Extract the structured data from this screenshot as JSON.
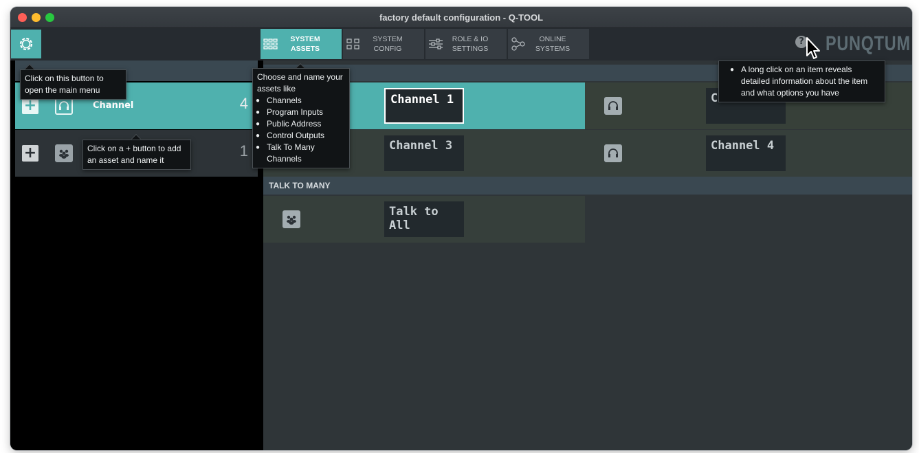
{
  "window": {
    "title": "factory default configuration - Q-TOOL"
  },
  "toolbar": {
    "tabs": [
      {
        "line1": "SYSTEM",
        "line2": "ASSETS",
        "icon": "grid-icon",
        "active": true
      },
      {
        "line1": "SYSTEM",
        "line2": "CONFIG",
        "icon": "modules-icon",
        "active": false
      },
      {
        "line1": "ROLE & IO",
        "line2": "SETTINGS",
        "icon": "sliders-icon",
        "active": false
      },
      {
        "line1": "ONLINE",
        "line2": "SYSTEMS",
        "icon": "network-icon",
        "active": false
      }
    ],
    "help_label": "?",
    "logo": "PUNQTUM"
  },
  "groups": [
    {
      "name": "Channel",
      "count": "4",
      "icon": "headset-icon",
      "add": "+"
    },
    {
      "name": "",
      "count": "1",
      "icon": "group-icon",
      "add": "+"
    }
  ],
  "channels": {
    "items": [
      "Channel 1",
      "C",
      "Channel 3",
      "Channel 4"
    ]
  },
  "talk_to_many": {
    "header": "TALK TO MANY",
    "items": [
      "Talk to All"
    ]
  },
  "tooltips": {
    "main_menu": "Click on this button to open the main menu",
    "add_asset": "Click on a + button to add an asset and name it",
    "assets_intro": "Choose and name your assets like",
    "assets_list": [
      "Channels",
      "Program Inputs",
      "Public Address",
      "Control Outputs",
      "Talk To Many Channels"
    ],
    "long_click": "A long click on an item reveals detailed information about the item and what options you have"
  },
  "colors": {
    "accent": "#4fb1ae",
    "panel": "#2f3538",
    "header": "#3a4851"
  }
}
